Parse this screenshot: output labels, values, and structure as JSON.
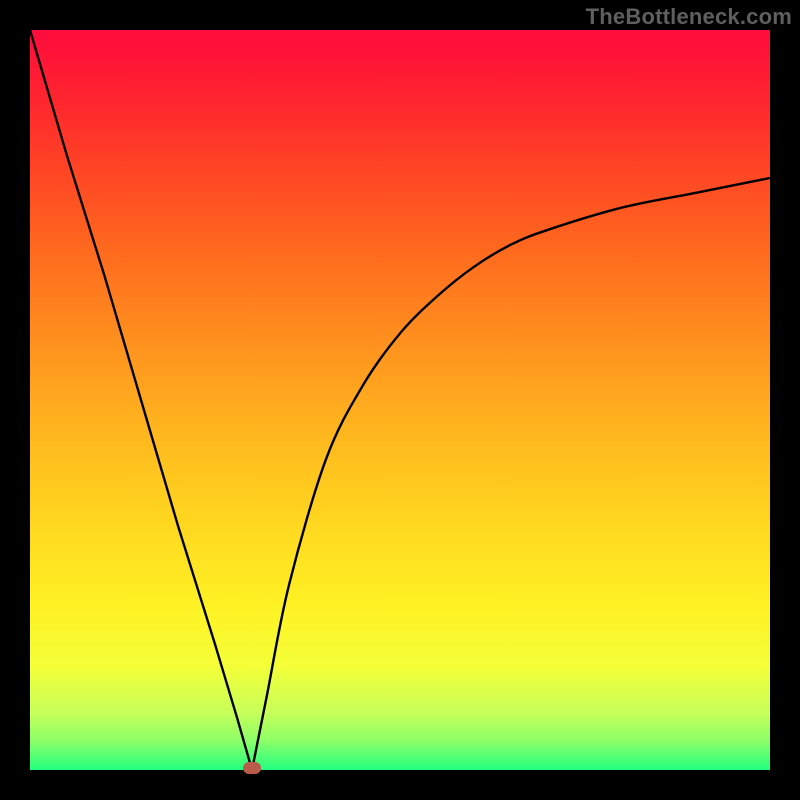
{
  "watermark": "TheBottleneck.com",
  "colors": {
    "frame": "#000000",
    "curve": "#000000",
    "marker": "#bb5b4b"
  },
  "chart_data": {
    "type": "line",
    "title": "",
    "xlabel": "",
    "ylabel": "",
    "xlim": [
      0,
      100
    ],
    "ylim": [
      0,
      100
    ],
    "grid": false,
    "legend": null,
    "series": [
      {
        "name": "bottleneck-curve",
        "x_notch": 30,
        "y_at_x0": 100,
        "y_at_notch": 0,
        "y_at_x100": 80,
        "x": [
          0,
          5,
          10,
          15,
          20,
          25,
          28,
          30,
          32,
          35,
          40,
          45,
          50,
          55,
          60,
          65,
          70,
          80,
          90,
          100
        ],
        "y": [
          100,
          83,
          67,
          50,
          33,
          17,
          7,
          0,
          10,
          25,
          42,
          52,
          59,
          64,
          68,
          71,
          73,
          76,
          78,
          80
        ]
      }
    ],
    "annotations": [
      {
        "type": "marker",
        "name": "min-point",
        "x": 30,
        "y": 0,
        "color": "#bb5b4b"
      }
    ]
  }
}
